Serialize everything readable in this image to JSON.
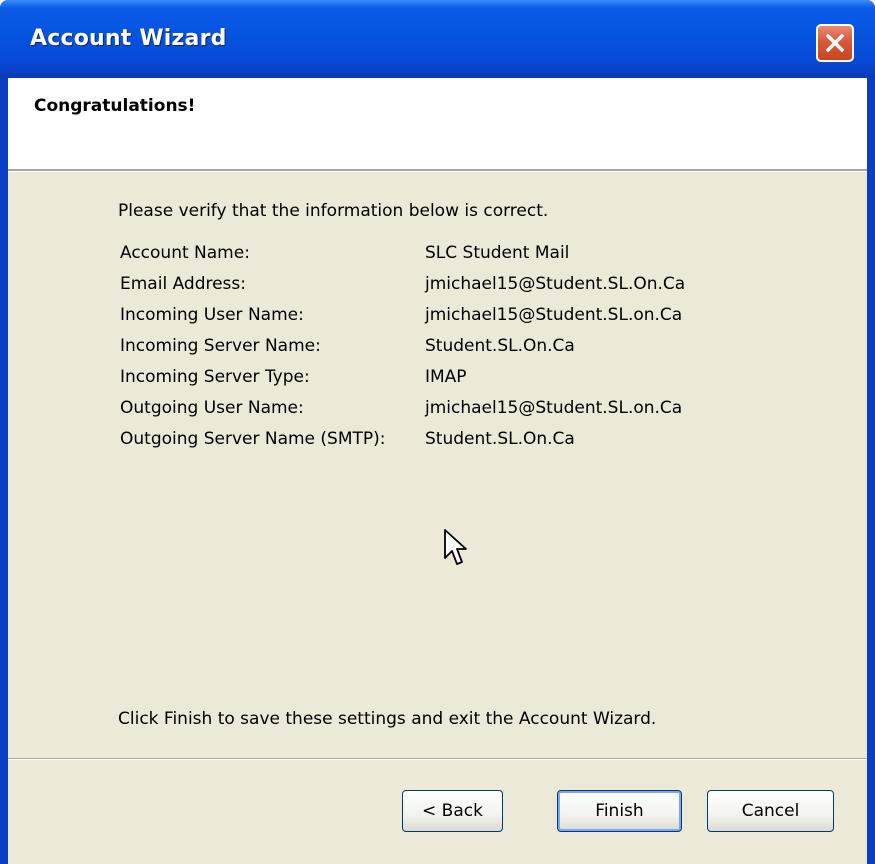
{
  "window": {
    "title": "Account Wizard"
  },
  "header": {
    "title": "Congratulations!"
  },
  "intro": "Please verify that the information below is correct.",
  "info": [
    {
      "label": "Account Name:",
      "value": "SLC Student Mail"
    },
    {
      "label": "Email Address:",
      "value": "jmichael15@Student.SL.On.Ca"
    },
    {
      "label": "Incoming User Name:",
      "value": "jmichael15@Student.SL.on.Ca"
    },
    {
      "label": "Incoming Server Name:",
      "value": "Student.SL.On.Ca"
    },
    {
      "label": "Incoming Server Type:",
      "value": "IMAP"
    },
    {
      "label": "Outgoing User Name:",
      "value": "jmichael15@Student.SL.on.Ca"
    },
    {
      "label": "Outgoing Server Name (SMTP):",
      "value": "Student.SL.On.Ca"
    }
  ],
  "footer_text": "Click Finish to save these settings and exit the Account Wizard.",
  "buttons": {
    "back": "< Back",
    "finish": "Finish",
    "cancel": "Cancel"
  },
  "icons": {
    "close": "close-icon",
    "cursor": "mouse-pointer-icon"
  }
}
